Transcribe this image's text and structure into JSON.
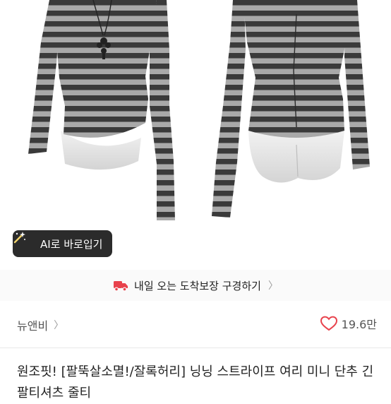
{
  "product": {
    "try_on_button_label": "AI로 바로입기",
    "delivery_banner_text": "내일 오는 도착보장 구경하기",
    "store_name": "뉴앤비",
    "like_count": "19.6만",
    "title": "원조핏! [팔뚝살소멸!/잘록허리] 닝닝 스트라이프 여리 미니 단추 긴팔티셔츠 줄티"
  },
  "icons": {
    "try_on": "magic-wand-icon",
    "delivery": "delivery-truck-icon",
    "chevron": "chevron-right-icon",
    "like": "heart-icon"
  },
  "colors": {
    "accent_red": "#e8424c",
    "button_dark": "#2b2b2b",
    "stripe_dark": "#3a3a3a",
    "stripe_light": "#a8a8a8"
  }
}
